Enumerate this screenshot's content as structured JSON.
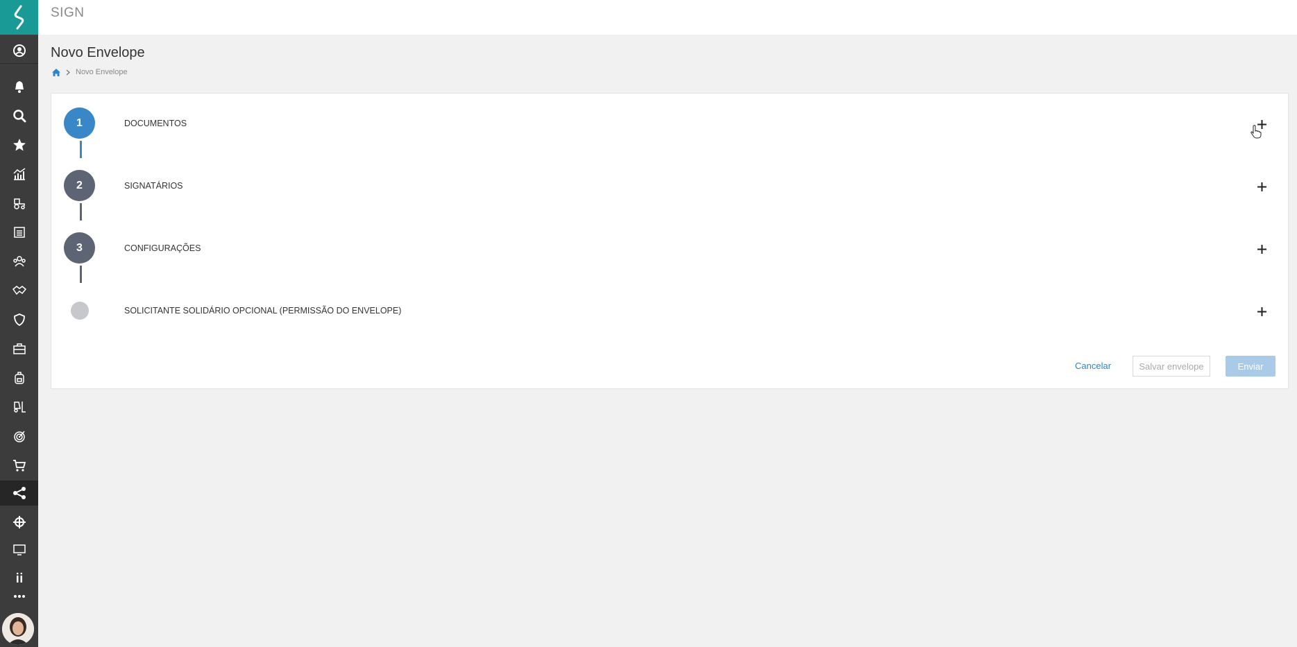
{
  "app": {
    "title": "SIGN"
  },
  "page": {
    "title": "Novo Envelope"
  },
  "breadcrumb": {
    "current": "Novo Envelope"
  },
  "steps": [
    {
      "number": "1",
      "label": "DOCUMENTOS",
      "state": "active"
    },
    {
      "number": "2",
      "label": "SIGNATÁRIOS",
      "state": "pending"
    },
    {
      "number": "3",
      "label": "CONFIGURAÇÕES",
      "state": "pending"
    },
    {
      "number": "",
      "label": "SOLICITANTE SOLIDÁRIO OPCIONAL (PERMISSÃO DO ENVELOPE)",
      "state": "optional"
    }
  ],
  "actions": {
    "cancel": "Cancelar",
    "save": "Salvar envelope",
    "send": "Enviar"
  },
  "sidebar": {
    "items": [
      "user-profile-icon",
      "bell-icon",
      "search-icon",
      "star-icon",
      "chart-icon",
      "tractor-icon",
      "inbox-icon",
      "team-icon",
      "handshake-icon",
      "shield-icon",
      "briefcase-icon",
      "backpack-icon",
      "forklift-icon",
      "target-icon",
      "cart-icon",
      "share-icon",
      "crosshair-icon",
      "monitor-icon",
      "pause-icon",
      "more-icon"
    ],
    "active": "share-icon"
  },
  "colors": {
    "brand": "#1a9a97",
    "sidebar": "#3c3c3c",
    "step_active": "#3a87c8",
    "step_pending": "#5d6575",
    "step_optional": "#c7c8cc",
    "link": "#2e86c9"
  }
}
